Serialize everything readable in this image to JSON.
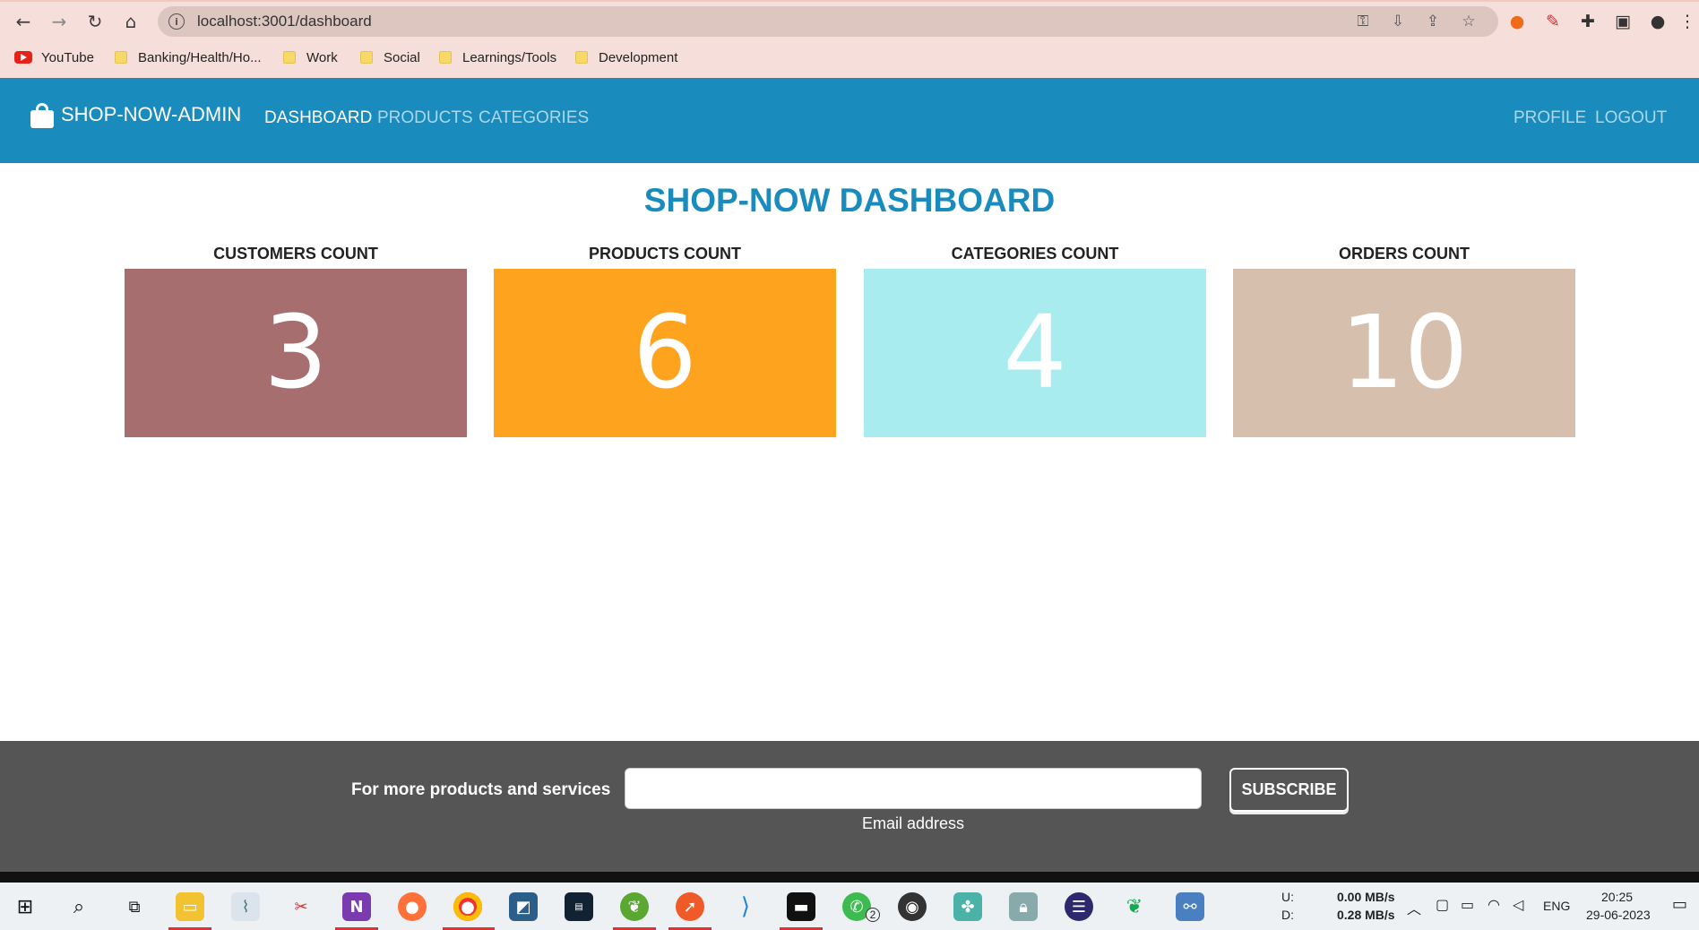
{
  "browser": {
    "url": "localhost:3001/dashboard",
    "bookmarks": [
      "YouTube",
      "Banking/Health/Ho...",
      "Work",
      "Social",
      "Learnings/Tools",
      "Development"
    ]
  },
  "navbar": {
    "brand": "SHOP-NOW-ADMIN",
    "links": [
      "DASHBOARD",
      "PRODUCTS",
      "CATEGORIES"
    ],
    "right_links": [
      "PROFILE",
      "LOGOUT"
    ]
  },
  "dashboard": {
    "title": "SHOP-NOW DASHBOARD",
    "cards": [
      {
        "label": "CUSTOMERS COUNT",
        "value": "3",
        "color": "#a66e6e"
      },
      {
        "label": "PRODUCTS COUNT",
        "value": "6",
        "color": "#fea31e"
      },
      {
        "label": "CATEGORIES COUNT",
        "value": "4",
        "color": "#a9ecef"
      },
      {
        "label": "ORDERS COUNT",
        "value": "10",
        "color": "#d7bfae"
      }
    ]
  },
  "footer": {
    "tagline": "For more products and services",
    "email_label": "Email address",
    "subscribe": "SUBSCRIBE"
  },
  "taskbar": {
    "net_up_label": "U:",
    "net_down_label": "D:",
    "net_up": "0.00 MB/s",
    "net_down": "0.28 MB/s",
    "language": "ENG",
    "time": "20:25",
    "date": "29-06-2023",
    "whatsapp_badge": "2"
  }
}
